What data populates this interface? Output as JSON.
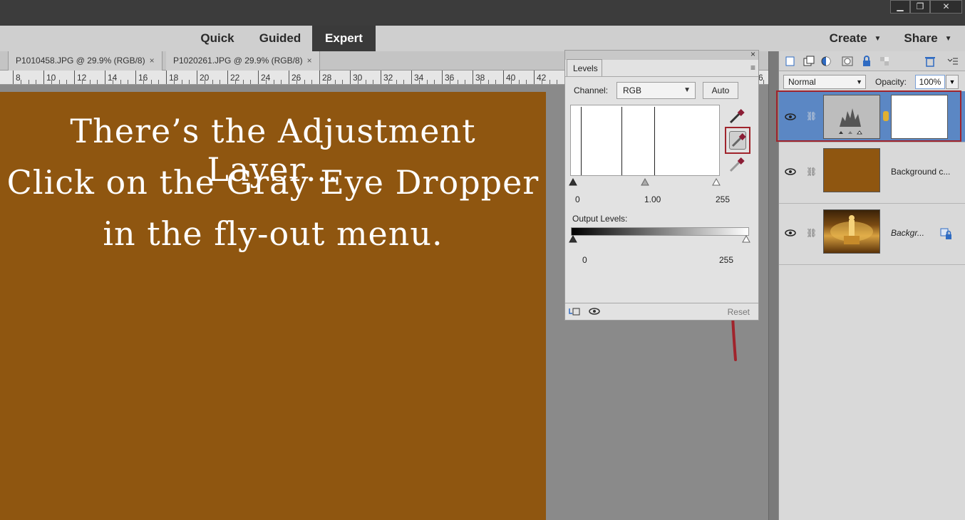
{
  "window": {
    "controls": [
      "▁",
      "❐",
      "✕"
    ]
  },
  "modes": {
    "quick": "Quick",
    "guided": "Guided",
    "expert": "Expert",
    "create": "Create",
    "share": "Share"
  },
  "tabs": [
    {
      "label": "P1010458.JPG @ 29.9% (RGB/8)",
      "close": "×"
    },
    {
      "label": "P1020261.JPG @ 29.9% (RGB/8)",
      "close": "×"
    }
  ],
  "ruler": {
    "numbers": [
      "8",
      "10",
      "12",
      "14",
      "16",
      "18",
      "20",
      "22",
      "24",
      "26",
      "28",
      "30",
      "32",
      "34",
      "36",
      "38",
      "40",
      "42",
      "6"
    ]
  },
  "overlay": {
    "line1": "There’s the Adjustment Layer…",
    "line2": "Click on the Gray Eye Dropper",
    "line3": "in the fly-out menu."
  },
  "levels": {
    "close": "×",
    "tab_label": "Levels",
    "menu_icon": "≡",
    "channel_label": "Channel:",
    "channel_value": "RGB",
    "auto_label": "Auto",
    "input_black": "0",
    "input_gamma": "1.00",
    "input_white": "255",
    "output_label": "Output Levels:",
    "output_black": "0",
    "output_white": "255",
    "reset_label": "Reset"
  },
  "layers": {
    "blend_mode": "Normal",
    "opacity_label": "Opacity:",
    "opacity_value": "100%",
    "items": [
      {
        "name": "",
        "selected": true
      },
      {
        "name": "Background c...",
        "selected": false
      },
      {
        "name": "Backgr...",
        "selected": false
      }
    ]
  },
  "colors": {
    "canvas_fill": "#8f5610",
    "highlight_red": "#a0242c",
    "selected_layer": "#5b87c4"
  }
}
